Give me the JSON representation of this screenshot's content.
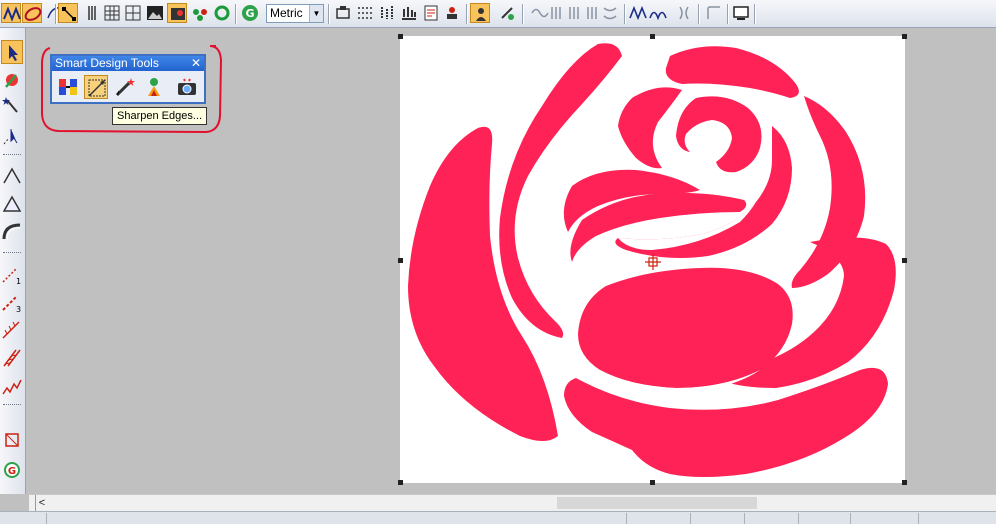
{
  "toolbar": {
    "units": {
      "selected": "Metric",
      "options": [
        "Metric"
      ]
    },
    "icons": [
      "wave-fill-icon",
      "satin-fill-icon",
      "point-node-icon",
      "vertical-stitch-icon",
      "grid-icon",
      "grid-alt-icon",
      "image-icon",
      "picture-edit-icon",
      "people-icon",
      "ring-icon",
      "green-logo-icon",
      "hoop-icon",
      "dotted-grid-icon",
      "column-chart-icon",
      "bar-chart-icon",
      "document-icon",
      "stamp-icon",
      "select-portrait-icon",
      "move-object-icon",
      "stitch-pattern-icons",
      "lettering-icons",
      "display-icons"
    ]
  },
  "palette": {
    "title": "Smart Design Tools",
    "close": "✕",
    "tooltip": "Sharpen Edges...",
    "tools": [
      "color-bars-tool",
      "sharpen-edges-tool",
      "magic-pen-tool",
      "paint-tool",
      "camera-tool"
    ]
  },
  "canvas": {
    "rose_color": "#ff2256",
    "background": "#ffffff"
  },
  "colors": {
    "annotation": "#e0102e",
    "active_tool": "#f8c35c"
  },
  "scrollbar": {
    "left_arrow": "<"
  }
}
